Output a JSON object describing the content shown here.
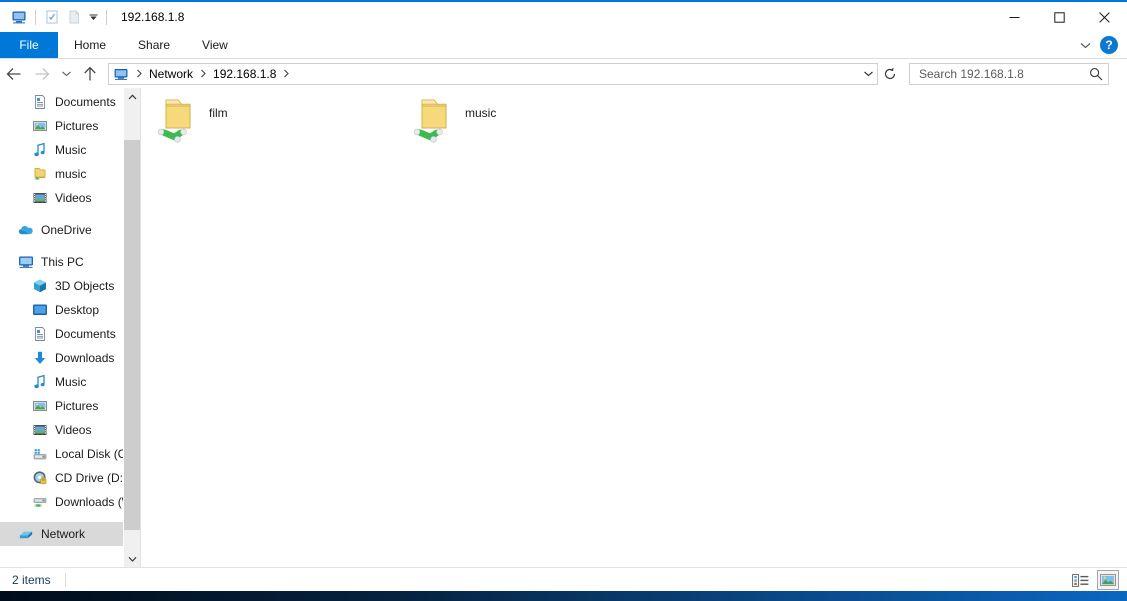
{
  "window": {
    "title": "192.168.1.8",
    "quick_access_icons": [
      "monitor-icon",
      "properties-checkbox-icon",
      "new-folder-icon"
    ],
    "quick_access_dropdown": "▾",
    "controls": {
      "minimize": "—",
      "maximize": "☐",
      "close": "✕"
    }
  },
  "ribbon": {
    "tabs": [
      {
        "label": "File",
        "active": true
      },
      {
        "label": "Home",
        "active": false
      },
      {
        "label": "Share",
        "active": false
      },
      {
        "label": "View",
        "active": false
      }
    ],
    "collapse_icon": "chevron-down-icon",
    "help_label": "?"
  },
  "address": {
    "back_icon": "arrow-left-icon",
    "forward_icon": "arrow-right-icon",
    "recent_icon": "chevron-down-icon",
    "up_icon": "arrow-up-icon",
    "breadcrumbs": [
      {
        "label": "Network"
      },
      {
        "label": "192.168.1.8"
      }
    ],
    "dropdown_icon": "chevron-down-icon",
    "refresh_icon": "refresh-icon"
  },
  "search": {
    "placeholder": "Search 192.168.1.8",
    "value": "",
    "icon": "search-icon"
  },
  "sidebar": {
    "groups": [
      {
        "items": [
          {
            "label": "Documents",
            "icon": "documents-icon",
            "indent": "indent1",
            "pinned": true
          },
          {
            "label": "Pictures",
            "icon": "pictures-icon",
            "indent": "indent1",
            "pinned": true
          },
          {
            "label": "Music",
            "icon": "music-note-icon",
            "indent": "indent1",
            "pinned": false
          },
          {
            "label": "music",
            "icon": "network-folder-icon",
            "indent": "indent1",
            "pinned": false
          },
          {
            "label": "Videos",
            "icon": "videos-icon",
            "indent": "indent1",
            "pinned": false
          }
        ]
      },
      {
        "items": [
          {
            "label": "OneDrive",
            "icon": "onedrive-cloud-icon",
            "indent": "root",
            "pinned": false
          }
        ]
      },
      {
        "items": [
          {
            "label": "This PC",
            "icon": "this-pc-icon",
            "indent": "root",
            "pinned": false
          },
          {
            "label": "3D Objects",
            "icon": "3d-objects-icon",
            "indent": "indent1",
            "pinned": false
          },
          {
            "label": "Desktop",
            "icon": "desktop-icon",
            "indent": "indent1",
            "pinned": false
          },
          {
            "label": "Documents",
            "icon": "documents-icon",
            "indent": "indent1",
            "pinned": false
          },
          {
            "label": "Downloads",
            "icon": "downloads-arrow-icon",
            "indent": "indent1",
            "pinned": false
          },
          {
            "label": "Music",
            "icon": "music-note-icon",
            "indent": "indent1",
            "pinned": false
          },
          {
            "label": "Pictures",
            "icon": "pictures-icon",
            "indent": "indent1",
            "pinned": false
          },
          {
            "label": "Videos",
            "icon": "videos-icon",
            "indent": "indent1",
            "pinned": false
          },
          {
            "label": "Local Disk (C:)",
            "icon": "hard-drive-icon",
            "indent": "indent1",
            "pinned": false
          },
          {
            "label": "CD Drive (D:) Vir",
            "icon": "cd-drive-icon",
            "indent": "indent1",
            "pinned": false
          },
          {
            "label": "Downloads (\\\\VB",
            "icon": "network-drive-icon",
            "indent": "indent1",
            "pinned": false
          }
        ]
      },
      {
        "items": [
          {
            "label": "Network",
            "icon": "network-icon",
            "indent": "root",
            "pinned": false,
            "selected": true
          }
        ]
      }
    ]
  },
  "main": {
    "files": [
      {
        "name": "film",
        "icon": "network-share-folder-icon"
      },
      {
        "name": "music",
        "icon": "network-share-folder-icon"
      }
    ]
  },
  "status": {
    "item_count": "2 items",
    "views": [
      {
        "name": "details-view",
        "active": false
      },
      {
        "name": "large-icons-view",
        "active": true
      }
    ]
  },
  "colors": {
    "accent": "#0078d7",
    "file_tab": "#0078d7",
    "selection": "#d9d9d9",
    "folder": "#f5d97a",
    "network_pipe": "#3dba4e"
  }
}
